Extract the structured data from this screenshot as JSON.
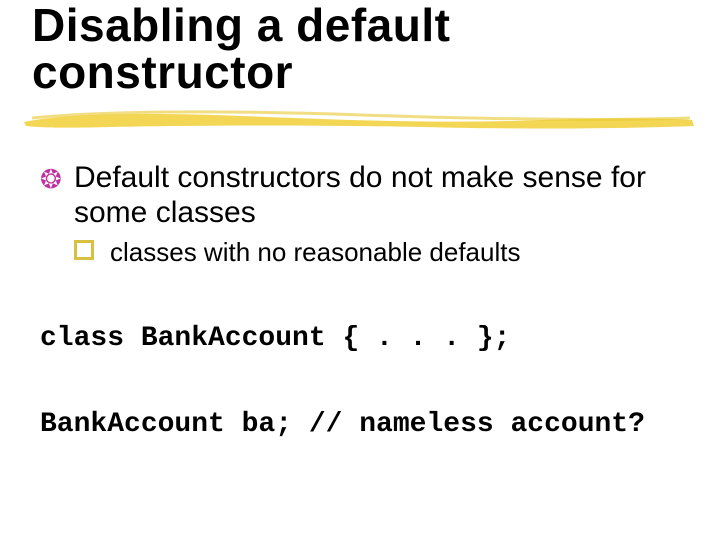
{
  "title_line1": "Disabling a default",
  "title_line2": "constructor",
  "bullets": {
    "b1": "Default constructors do not make sense for some classes",
    "b1a": "classes with no reasonable defaults"
  },
  "code": {
    "line1": "class BankAccount { . . . };",
    "line2": "BankAccount ba; // nameless account?"
  }
}
